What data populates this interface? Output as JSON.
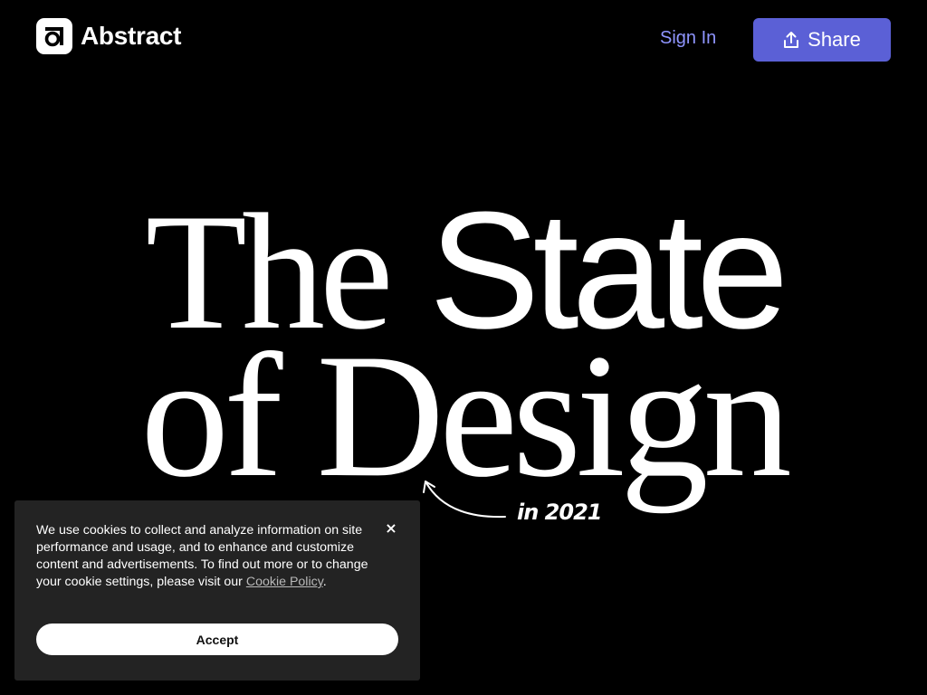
{
  "header": {
    "brand": "Abstract",
    "logo_icon": "abstract-logo-icon",
    "sign_in_label": "Sign In",
    "share_label": "Share",
    "share_icon": "upload-share-icon"
  },
  "hero": {
    "word_the": "The",
    "word_state": "State",
    "word_of": "of",
    "word_design": "Design",
    "year_note": "in 2021"
  },
  "cookie_banner": {
    "message": "We use cookies to collect and analyze information on site performance and usage, and to enhance and customize content and advertisements. To find out more or to change your cookie settings, please visit our ",
    "link_text": "Cookie Policy",
    "trailing": ".",
    "close_label": "×",
    "accept_label": "Accept"
  },
  "colors": {
    "background": "#000000",
    "accent": "#5b60d6",
    "sign_in": "#8f95ff",
    "banner": "#232323"
  }
}
